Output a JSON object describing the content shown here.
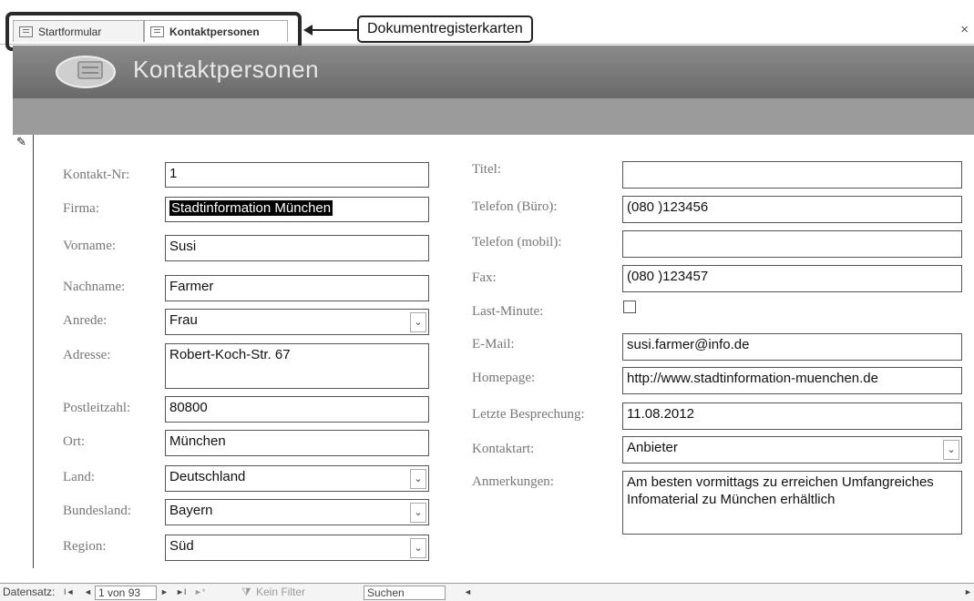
{
  "tabs": [
    {
      "label": "Startformular"
    },
    {
      "label": "Kontaktpersonen"
    }
  ],
  "callout": "Dokumentregisterkarten",
  "close_glyph": "×",
  "header": {
    "title": "Kontaktpersonen"
  },
  "left_fields": {
    "kontakt_nr": {
      "label": "Kontakt-Nr:",
      "value": "1"
    },
    "firma": {
      "label": "Firma:",
      "value": "Stadtinformation München"
    },
    "vorname": {
      "label": "Vorname:",
      "value": "Susi"
    },
    "nachname": {
      "label": "Nachname:",
      "value": "Farmer"
    },
    "anrede": {
      "label": "Anrede:",
      "value": "Frau"
    },
    "adresse": {
      "label": "Adresse:",
      "value": "Robert-Koch-Str. 67"
    },
    "postleitzahl": {
      "label": "Postleitzahl:",
      "value": "80800"
    },
    "ort": {
      "label": "Ort:",
      "value": "München"
    },
    "land": {
      "label": "Land:",
      "value": "Deutschland"
    },
    "bundesland": {
      "label": "Bundesland:",
      "value": "Bayern"
    },
    "region": {
      "label": "Region:",
      "value": "Süd"
    }
  },
  "right_fields": {
    "titel": {
      "label": "Titel:",
      "value": ""
    },
    "telefon_buero": {
      "label": "Telefon (Büro):",
      "value": "(080  )123456"
    },
    "telefon_mobil": {
      "label": "Telefon (mobil):",
      "value": ""
    },
    "fax": {
      "label": "Fax:",
      "value": "(080  )123457"
    },
    "last_minute": {
      "label": "Last-Minute:",
      "checked": false
    },
    "email": {
      "label": "E-Mail:",
      "value": "susi.farmer@info.de"
    },
    "homepage": {
      "label": "Homepage:",
      "value": "http://www.stadtinformation-muenchen.de"
    },
    "letzte_besprechung": {
      "label": "Letzte Besprechung:",
      "value": "11.08.2012"
    },
    "kontaktart": {
      "label": "Kontaktart:",
      "value": "Anbieter"
    },
    "anmerkungen": {
      "label": "Anmerkungen:",
      "value": "Am besten vormittags zu erreichen Umfangreiches Infomaterial zu München erhältlich"
    }
  },
  "navbar": {
    "label": "Datensatz:",
    "first": "I◄",
    "prev": "◄",
    "position": "1 von 93",
    "next": "►",
    "last": "►I",
    "new": "►*",
    "filter": "Kein Filter",
    "search": "Suchen",
    "scroll_left": "◄",
    "scroll_right": "►"
  },
  "icons": [
    "form-icon",
    "close-icon",
    "pencil-icon",
    "dropdown-arrow-icon",
    "filter-icon"
  ]
}
